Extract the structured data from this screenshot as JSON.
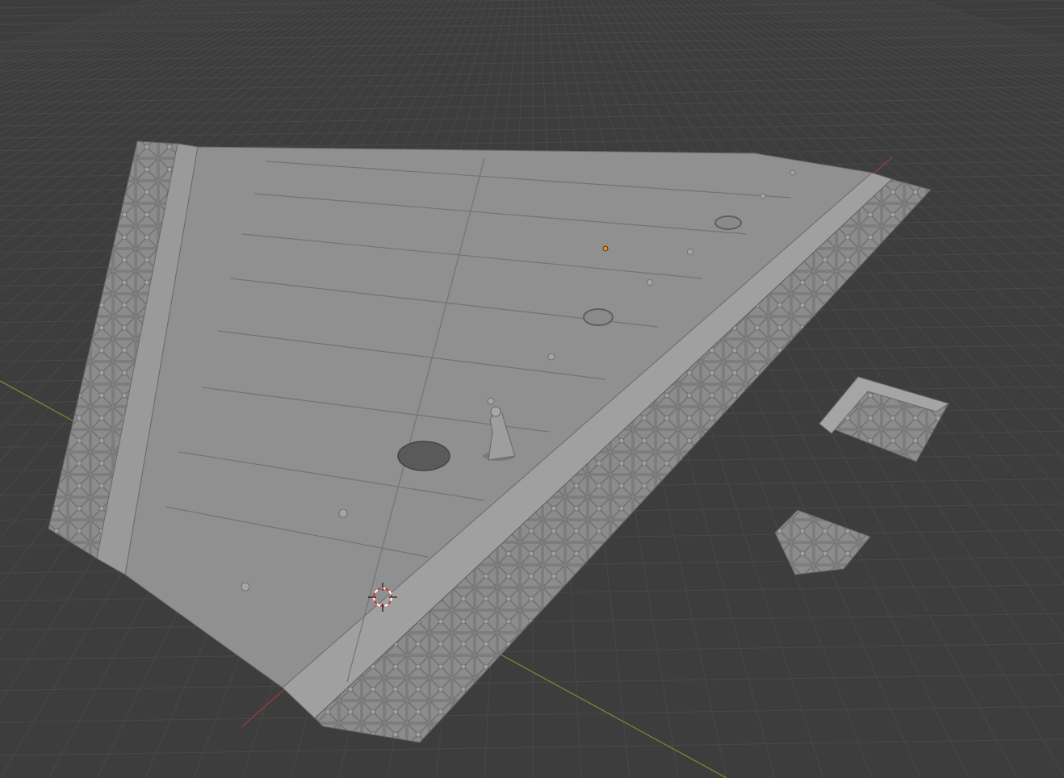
{
  "viewport": {
    "mode": "solid-shading",
    "background_color": "#3d3d3d",
    "grid_color": "#484848",
    "x_axis_color": "#9a3b3b",
    "y_axis_color": "#6b8e2f",
    "model_color": "#8f8f8f",
    "origin_marker_color": "#ff8c00",
    "cursor_icon": "3d-cursor-icon"
  },
  "scene": {
    "main_object": "corridor-floor-tiles",
    "figure": "miniature-figure",
    "loose_parts": [
      "corner-gutter-tile",
      "single-floor-tile"
    ]
  }
}
